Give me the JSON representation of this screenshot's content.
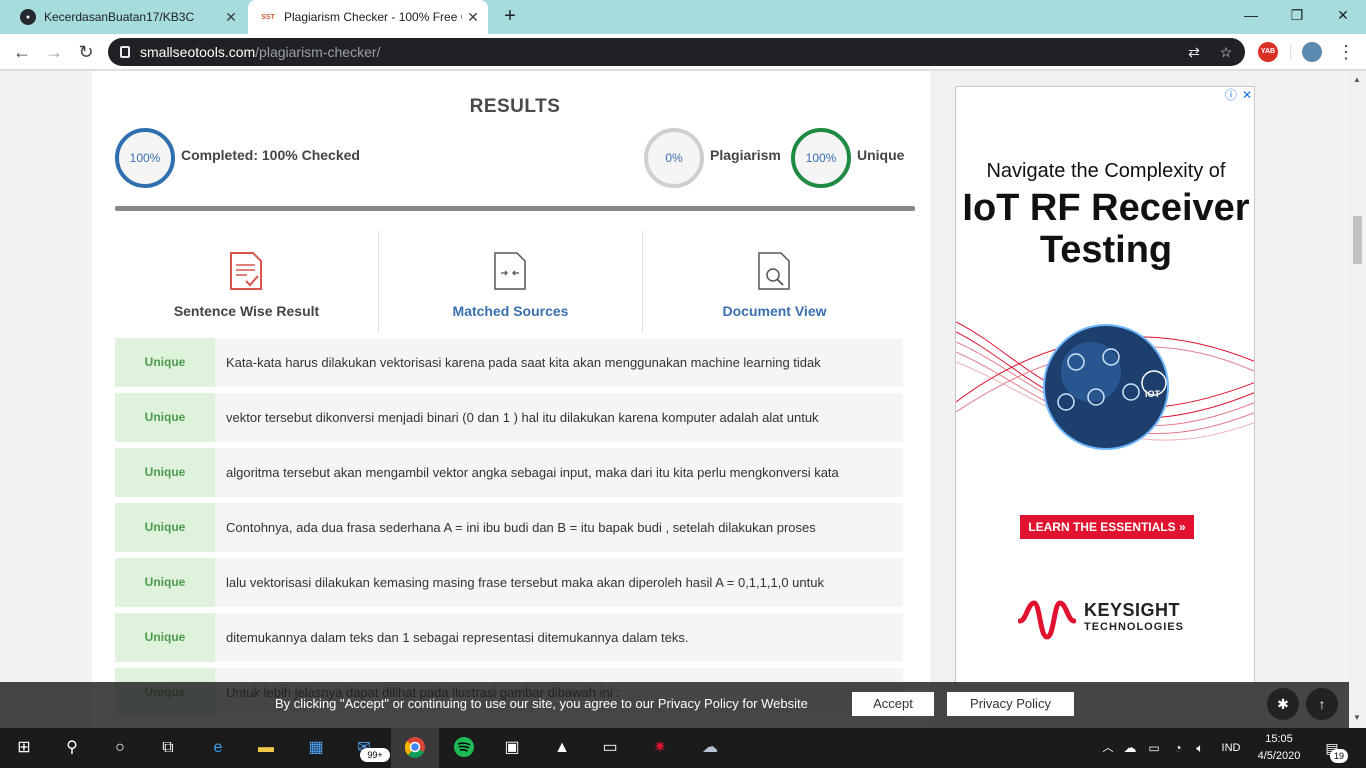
{
  "browser": {
    "tabs": [
      {
        "title": "KecerdasanBuatan17/KB3C",
        "favicon": "github-icon"
      },
      {
        "title": "Plagiarism Checker - 100% Free O",
        "favicon": "sst-icon",
        "favicon_text": "SST"
      }
    ],
    "new_tab_label": "+",
    "url_host": "smallseotools.com",
    "url_path": "/plagiarism-checker/",
    "extension_badge": "YAB"
  },
  "results": {
    "title": "RESULTS",
    "completed_pct": "100%",
    "completed_label": "Completed: 100% Checked",
    "plagiarism_pct": "0%",
    "plagiarism_label": "Plagiarism",
    "unique_pct": "100%",
    "unique_label": "Unique",
    "progress": 1.0
  },
  "result_tabs": [
    {
      "label": "Sentence Wise Result"
    },
    {
      "label": "Matched Sources"
    },
    {
      "label": "Document View"
    }
  ],
  "sentences": [
    {
      "status": "Unique",
      "text": "Kata-kata harus dilakukan vektorisasi karena pada saat kita akan menggunakan machine learning tidak"
    },
    {
      "status": "Unique",
      "text": "vektor tersebut dikonversi menjadi binari (0 dan 1 ) hal itu dilakukan karena komputer adalah alat untuk"
    },
    {
      "status": "Unique",
      "text": "algoritma tersebut akan mengambil vektor angka sebagai input, maka dari itu kita perlu mengkonversi kata"
    },
    {
      "status": "Unique",
      "text": "Contohnya, ada dua frasa sederhana A = ini ibu budi dan B = itu bapak budi , setelah dilakukan proses"
    },
    {
      "status": "Unique",
      "text": "lalu vektorisasi dilakukan kemasing masing frase tersebut maka akan diperoleh hasil A = 0,1,1,1,0 untuk"
    },
    {
      "status": "Unique",
      "text": "ditemukannya dalam teks dan 1 sebagai representasi ditemukannya dalam teks."
    },
    {
      "status": "Unique",
      "text": "Untuk lebih jelasnya dapat dilihat pada ilustrasi gambar dibawah ini :"
    }
  ],
  "ad": {
    "headline_small": "Navigate the Complexity of",
    "headline_large": "IoT RF Receiver Testing",
    "cta": "LEARN THE ESSENTIALS",
    "brand": "KEYSIGHT",
    "brand_sub": "TECHNOLOGIES",
    "badge_text": "IOT"
  },
  "cookie": {
    "text": "By clicking \"Accept\" or continuing to use our site, you agree to our Privacy Policy for Website",
    "accept": "Accept",
    "privacy": "Privacy Policy"
  },
  "taskbar": {
    "language": "IND",
    "time": "15:05",
    "date": "4/5/2020",
    "mail_badge": "99+",
    "notification_count": "19"
  }
}
